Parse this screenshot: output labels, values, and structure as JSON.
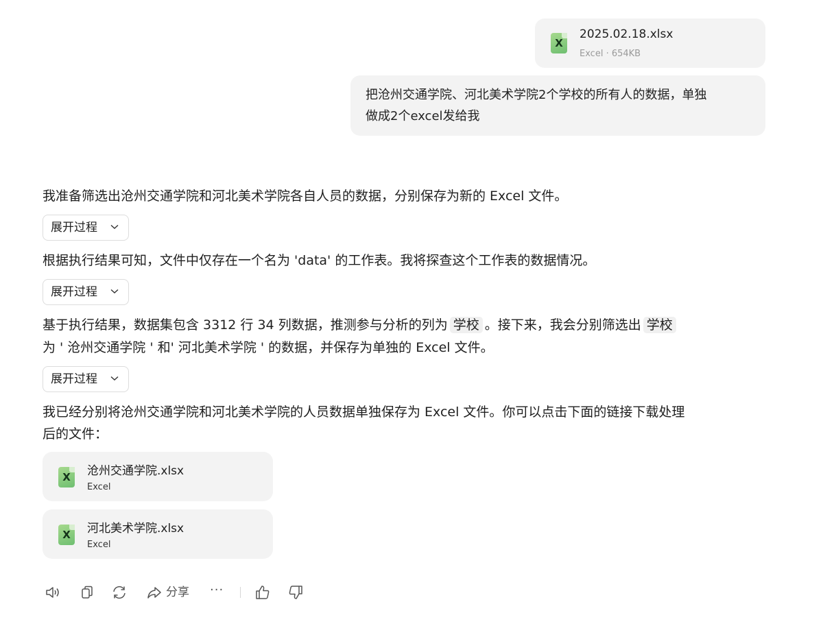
{
  "user": {
    "attachment": {
      "name": "2025.02.18.xlsx",
      "meta": "Excel · 654KB",
      "icon": "excel-file-icon",
      "icon_letter": "X"
    },
    "message_line1": "把沧州交通学院、河北美术学院2个学校的所有人的数据，单独",
    "message_line2": "做成2个excel发给我"
  },
  "assistant": {
    "p1": "我准备筛选出沧州交通学院和河北美术学院各自人员的数据，分别保存为新的 Excel 文件。",
    "expand_label": "展开过程",
    "p2": "根据执行结果可知，文件中仅存在一个名为 'data' 的工作表。我将探查这个工作表的数据情况。",
    "p3_line1_a": "基于执行结果，数据集包含 3312 行 34 列数据，推测参与分析的列为",
    "p3_code": "学校",
    "p3_line1_b": "。接下来，我会分别筛选出",
    "p3_line2": "为 ' 沧州交通学院 ' 和' 河北美术学院 ' 的数据，并保存为单独的 Excel 文件。",
    "p4_line1": "我已经分别将沧州交通学院和河北美术学院的人员数据单独保存为 Excel 文件。你可以点击下面的链接下载处理",
    "p4_line2": "后的文件：",
    "files": [
      {
        "name": "沧州交通学院.xlsx",
        "type": "Excel",
        "icon_letter": "X"
      },
      {
        "name": "河北美术学院.xlsx",
        "type": "Excel",
        "icon_letter": "X"
      }
    ]
  },
  "toolbar": {
    "share_label": "分享",
    "more_label": "···",
    "icons": [
      "speaker-icon",
      "copy-icon",
      "regenerate-icon",
      "share-icon",
      "more-icon",
      "thumbs-up-icon",
      "thumbs-down-icon"
    ]
  },
  "colors": {
    "bubble": "#f3f3f3",
    "excel_green": "#6fbf71",
    "text": "#1f1f1f",
    "muted": "#9a9a9a"
  }
}
